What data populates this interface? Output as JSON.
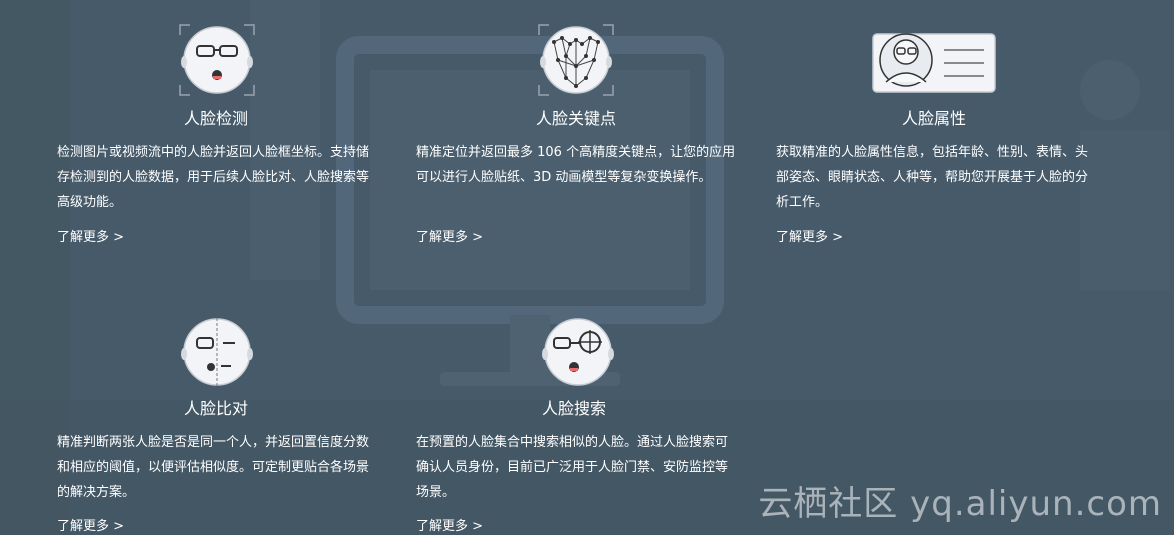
{
  "features": [
    {
      "title": "人脸检测",
      "desc": "检测图片或视频流中的人脸并返回人脸框坐标。支持储存检测到的人脸数据，用于后续人脸比对、人脸搜索等高级功能。",
      "more": "了解更多 >",
      "icon": "face-detection-icon"
    },
    {
      "title": "人脸关键点",
      "desc": "精准定位并返回最多 106 个高精度关键点，让您的应用可以进行人脸贴纸、3D 动画模型等复杂变换操作。",
      "more": "了解更多 >",
      "icon": "face-keypoints-icon"
    },
    {
      "title": "人脸属性",
      "desc": "获取精准的人脸属性信息，包括年龄、性别、表情、头部姿态、眼睛状态、人种等，帮助您开展基于人脸的分析工作。",
      "more": "了解更多 >",
      "icon": "face-attributes-icon"
    },
    {
      "title": "人脸比对",
      "desc": "精准判断两张人脸是否是同一个人，并返回置信度分数和相应的阈值，以便评估相似度。可定制更贴合各场景的解决方案。",
      "more": "了解更多 >",
      "icon": "face-compare-icon"
    },
    {
      "title": "人脸搜索",
      "desc": "在预置的人脸集合中搜索相似的人脸。通过人脸搜索可确认人员身份，目前已广泛用于人脸门禁、安防监控等场景。",
      "more": "了解更多 >",
      "icon": "face-search-icon"
    }
  ],
  "watermark": "云栖社区 yq.aliyun.com"
}
